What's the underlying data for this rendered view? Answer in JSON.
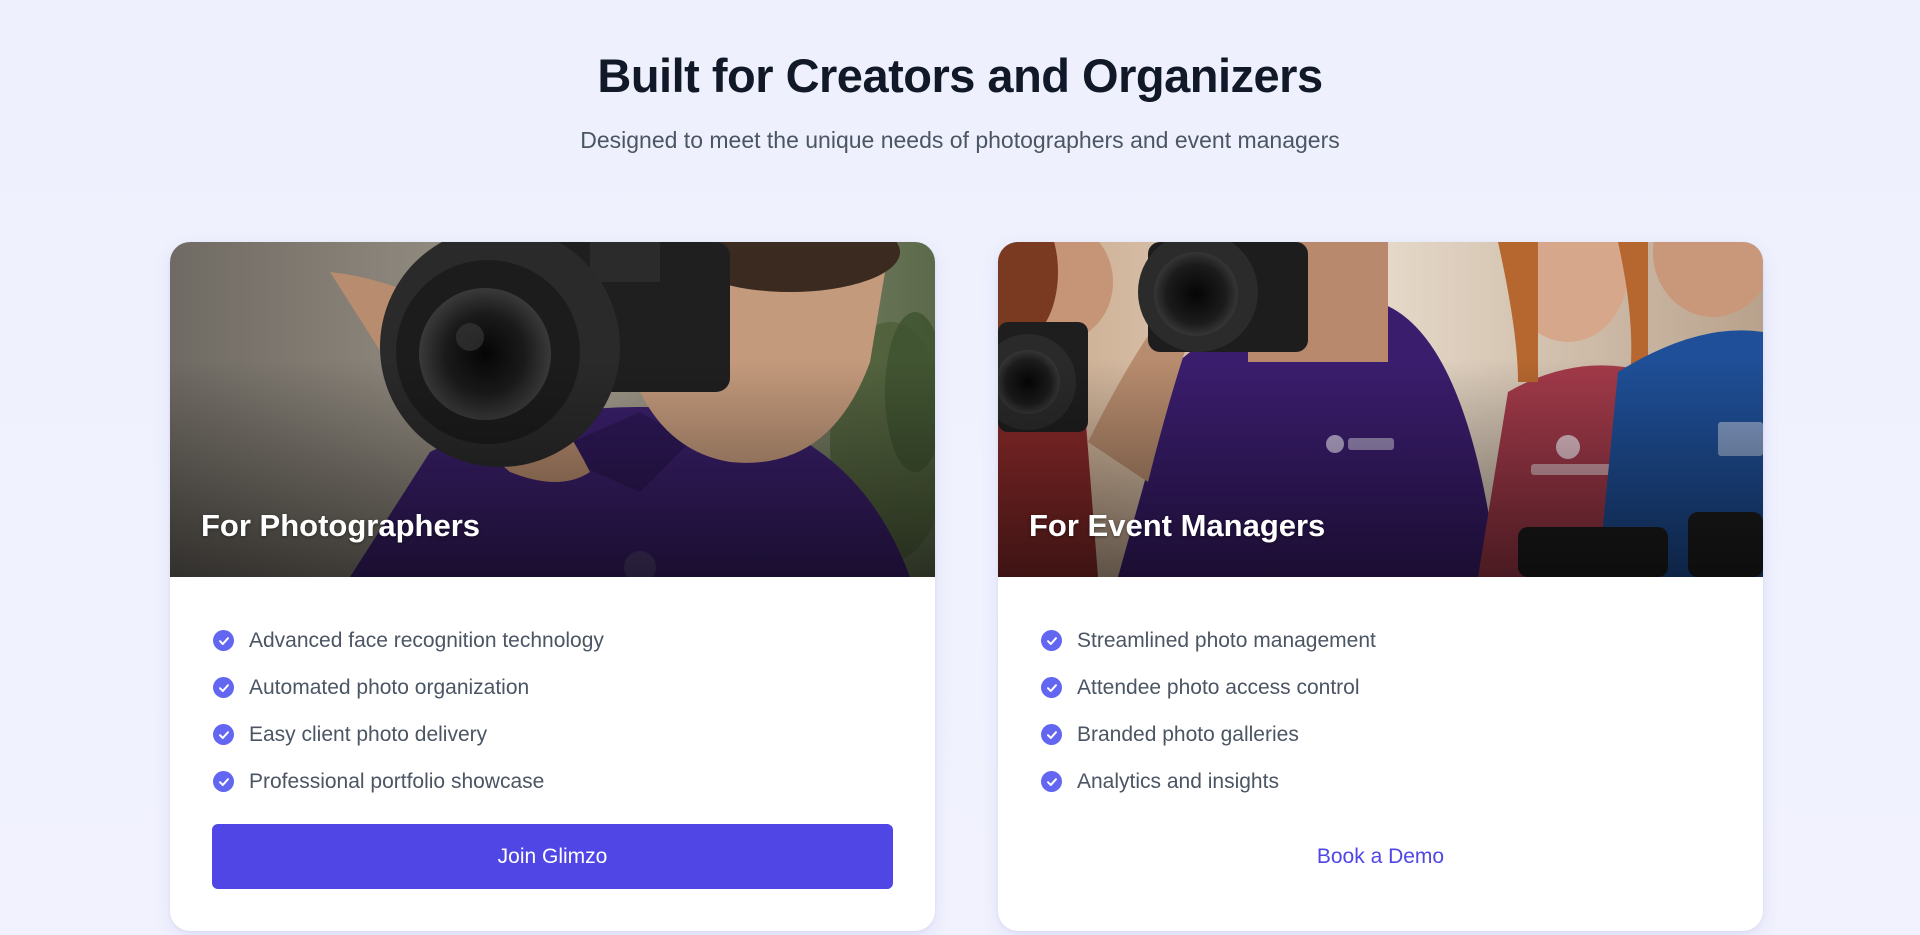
{
  "section": {
    "title": "Built for Creators and Organizers",
    "subtitle": "Designed to meet the unique needs of photographers and event managers"
  },
  "cards": [
    {
      "title": "For Photographers",
      "image": "photographer-with-camera-photo",
      "features": [
        "Advanced face recognition technology",
        "Automated photo organization",
        "Easy client photo delivery",
        "Professional portfolio showcase"
      ],
      "cta_label": "Join Glimzo",
      "cta_style": "primary-button"
    },
    {
      "title": "For Event Managers",
      "image": "event-staff-group-photo",
      "features": [
        "Streamlined photo management",
        "Attendee photo access control",
        "Branded photo galleries",
        "Analytics and insights"
      ],
      "cta_label": "Book a Demo",
      "cta_style": "text-link"
    }
  ],
  "icons": {
    "feature_bullet": "check-circle-icon"
  },
  "colors": {
    "accent": "#4f46e5",
    "check": "#6366f1",
    "heading": "#111827",
    "body_text": "#4b5563",
    "background": "#eef1fd"
  }
}
